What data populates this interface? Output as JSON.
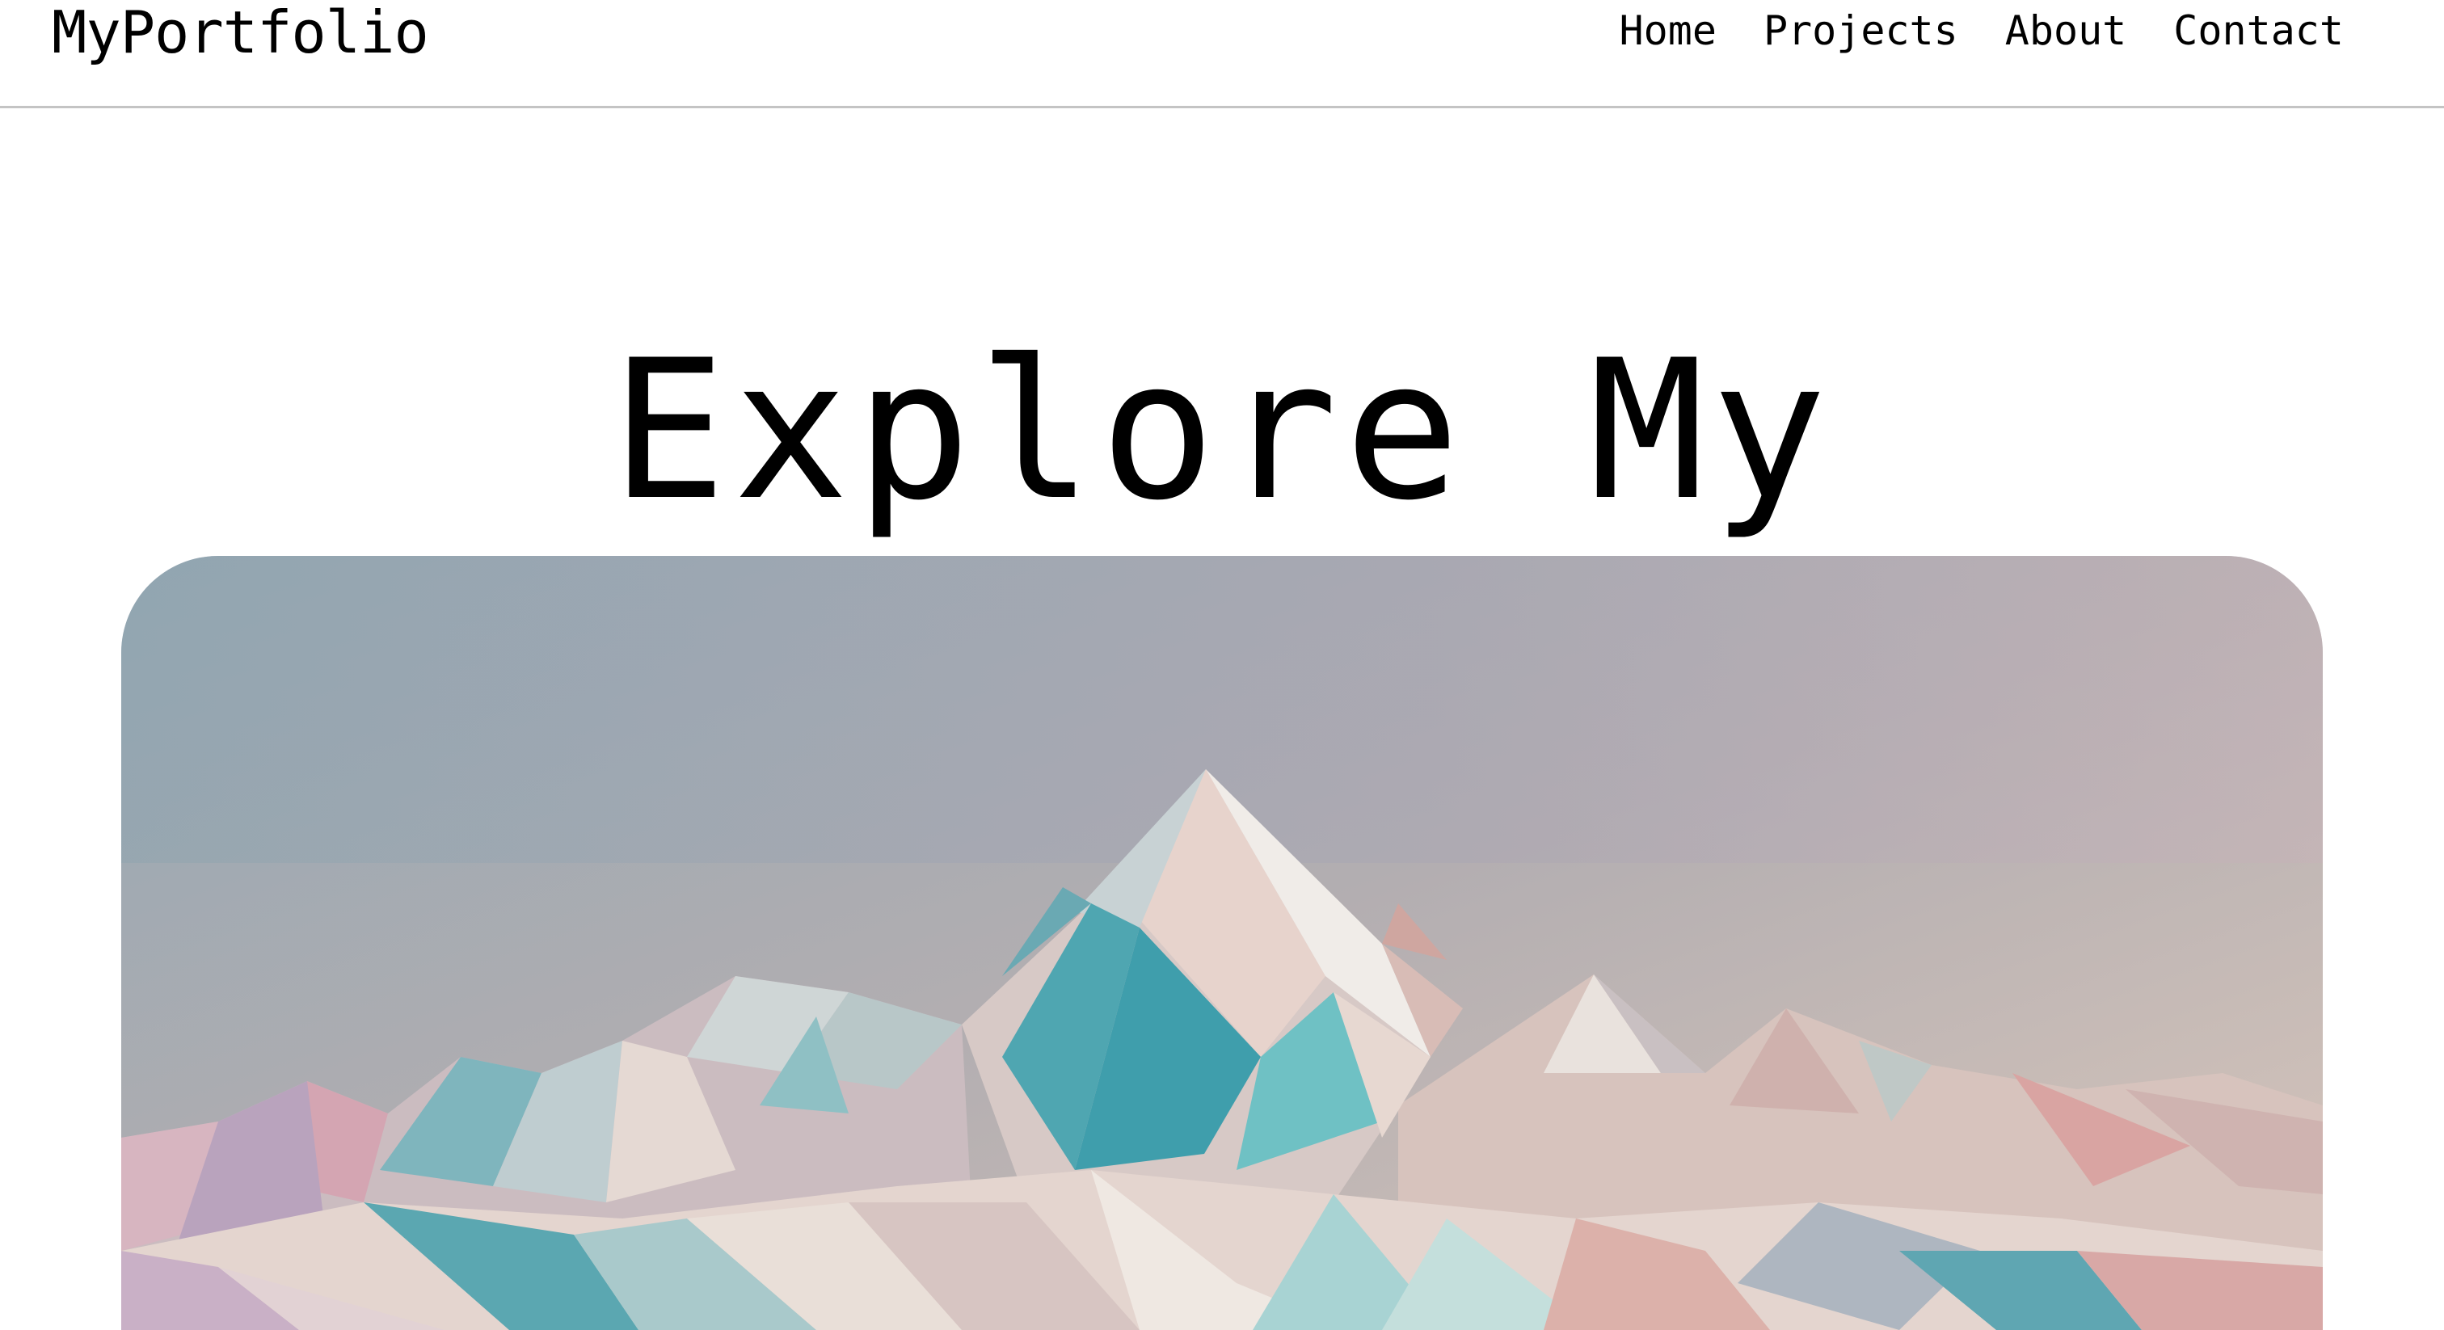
{
  "brand": {
    "name": "MyPortfolio"
  },
  "nav": {
    "items": [
      {
        "label": "Home"
      },
      {
        "label": "Projects"
      },
      {
        "label": "About"
      },
      {
        "label": "Contact"
      }
    ]
  },
  "hero": {
    "title": "Explore My Portfolio",
    "image": {
      "subject": "low-poly-mountains"
    }
  },
  "colors": {
    "sky_top": "#98a8b2",
    "sky_bottom": "#cfc2b9",
    "teal": "#5aacb6",
    "pink": "#d9a9a6",
    "white_peak": "#ece6e0",
    "lilac": "#b9a4bd",
    "divider": "#c4c4c4"
  }
}
